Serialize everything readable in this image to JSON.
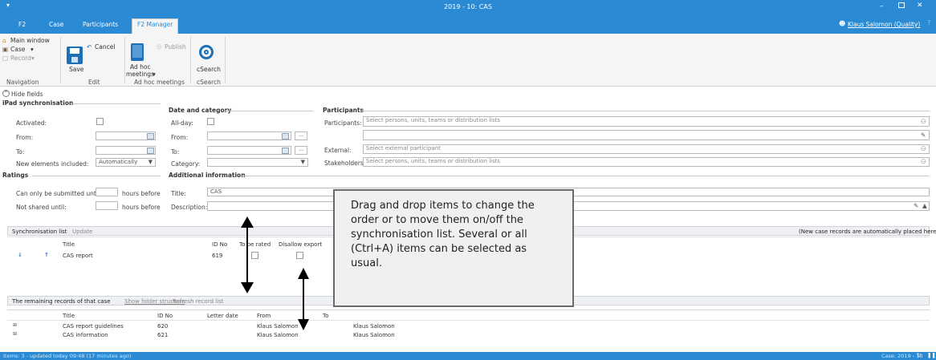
{
  "window": {
    "title": "2019 - 10: CAS",
    "user": "Klaus Salomon (Quality)"
  },
  "tabs": [
    "F2",
    "Case",
    "Participants",
    "F2 Manager"
  ],
  "ribbon": {
    "main_window": "Main window",
    "case": "Case",
    "record": "Record",
    "cancel": "Cancel",
    "save": "Save",
    "publish": "Publish",
    "ad_hoc": "Ad hoc",
    "meetings": "meetings",
    "csearch": "cSearch",
    "groups": [
      "Navigation",
      "Edit",
      "Ad hoc meetings",
      "cSearch"
    ]
  },
  "form": {
    "hide_fields": "Hide fields",
    "ipad": {
      "title": "iPad synchronisation",
      "activated": "Activated:",
      "from": "From:",
      "to": "To:",
      "new_elements": "New elements included:",
      "new_elements_value": "Automatically"
    },
    "date_category": {
      "title": "Date and category",
      "all_day": "All-day:",
      "from": "From:",
      "to": "To:",
      "category": "Category:"
    },
    "participants": {
      "title": "Participants",
      "participants_label": "Participants:",
      "participants_placeholder": "Select persons, units, teams or distribution lists",
      "external_label": "External:",
      "external_placeholder": "Select external participant",
      "stakeholders_label": "Stakeholders:",
      "stakeholders_placeholder": "Select persons, units, teams or distribution lists"
    },
    "ratings": {
      "title": "Ratings",
      "submitted_until": "Can only be submitted until:",
      "not_shared": "Not shared until:",
      "hours_before": "hours before"
    },
    "additional": {
      "title": "Additional information",
      "title_label": "Title:",
      "title_value": "CAS",
      "description_label": "Description:"
    }
  },
  "sync": {
    "label": "Synchronisation list",
    "update": "Update",
    "note": "(New case records are automatically placed here)",
    "columns": [
      "Title",
      "ID No",
      "To be rated",
      "Disallow export"
    ],
    "rows": [
      {
        "title": "CAS report",
        "id": "619"
      }
    ]
  },
  "remaining": {
    "label": "The remaining records of that case",
    "show_folder": "Show folder structure",
    "refresh": "Refresh record list",
    "columns": [
      "Title",
      "ID No",
      "Letter date",
      "From",
      "To"
    ],
    "rows": [
      {
        "title": "CAS report guidelines",
        "id": "620",
        "from": "Klaus Salomon",
        "to": "Klaus Salomon"
      },
      {
        "title": "CAS information",
        "id": "621",
        "from": "Klaus Salomon",
        "to": "Klaus Salomon"
      }
    ]
  },
  "callout": "Drag and drop items to change the order or to move them on/off the synchronisation list. Several or all (Ctrl+A) items can be selected as usual.",
  "status": {
    "left": "Items: 3 - updated today 09:48 (17 minutes ago)",
    "right": "Case: 2019 - 10"
  }
}
